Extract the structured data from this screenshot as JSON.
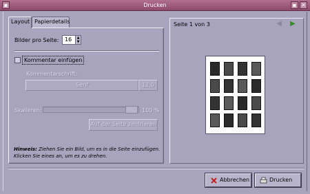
{
  "window": {
    "title": "Drucken"
  },
  "tabs": [
    {
      "label": "Layout"
    },
    {
      "label": "Papierdetails"
    }
  ],
  "layout": {
    "images_per_page_label": "Bilder pro Seite:",
    "images_per_page_value": "16",
    "comment_checkbox_label": "Kommentar einfügen",
    "comment_checked": false,
    "comment_font_label": "Kommentarschrift:",
    "font_name": "Serif",
    "font_size": "12,0",
    "scale_label": "Skalieren:",
    "scale_value": "100 %",
    "scale_fraction": 1.0,
    "center_button": "Auf der Seite zentrieren",
    "hint_bold": "Hinweis:",
    "hint_text": " Ziehen Sie ein Bild, um es in die Seite einzufügen. Klicken Sie eines an, um es zu drehen."
  },
  "preview": {
    "page_indicator": "Seite 1 von 3",
    "thumb_count": 16
  },
  "buttons": {
    "cancel": "Abbrechen",
    "print": "Drucken"
  },
  "colors": {
    "titlebar": "#9a5a7a",
    "background": "#a9a4be",
    "accent_arrow": "#3a8a2a"
  }
}
